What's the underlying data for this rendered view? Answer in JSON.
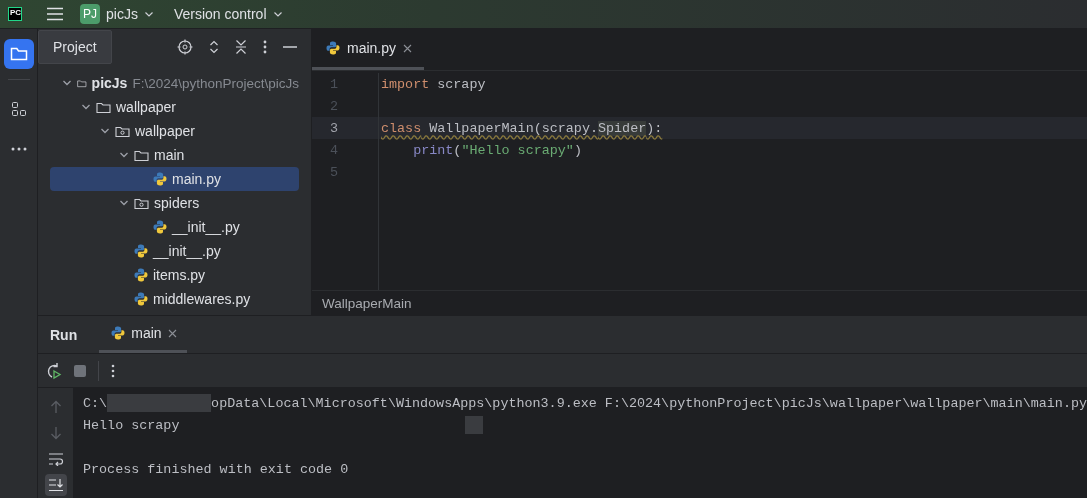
{
  "title_bar": {
    "logo": "PC",
    "project_badge": "PJ",
    "project": "picJs",
    "vcs": "Version control"
  },
  "tool_stripe": [
    {
      "kind": "project",
      "selected": true
    },
    {
      "kind": "structure",
      "selected": false
    },
    {
      "kind": "more",
      "selected": false
    }
  ],
  "project_panel": {
    "title": "Project",
    "tree": [
      {
        "label": "picJs",
        "path": "F:\\2024\\pythonProject\\picJs",
        "kind": "folder",
        "expanded": true,
        "selected": false,
        "children": [
          {
            "label": "wallpaper",
            "kind": "folder",
            "expanded": true,
            "selected": false,
            "children": [
              {
                "label": "wallpaper",
                "kind": "package",
                "expanded": true,
                "selected": false,
                "children": [
                  {
                    "label": "main",
                    "kind": "folder",
                    "expanded": true,
                    "selected": false,
                    "children": [
                      {
                        "label": "main.py",
                        "kind": "python",
                        "selected": true
                      }
                    ]
                  },
                  {
                    "label": "spiders",
                    "kind": "package",
                    "expanded": true,
                    "selected": false,
                    "children": [
                      {
                        "label": "__init__.py",
                        "kind": "python",
                        "selected": false
                      }
                    ]
                  },
                  {
                    "label": "__init__.py",
                    "kind": "python",
                    "selected": false
                  },
                  {
                    "label": "items.py",
                    "kind": "python",
                    "selected": false
                  },
                  {
                    "label": "middlewares.py",
                    "kind": "python",
                    "selected": false
                  }
                ]
              }
            ]
          }
        ]
      }
    ]
  },
  "editor": {
    "tabs": [
      {
        "label": "main.py",
        "selected": true
      }
    ],
    "lines": [
      {
        "number": "1",
        "current": false,
        "tokens": [
          {
            "text": "import",
            "kind": "keyword",
            "highlighted": false,
            "warning": false
          },
          {
            "text": " scrapy",
            "kind": "name",
            "highlighted": false,
            "warning": false
          }
        ]
      },
      {
        "number": "2",
        "current": false
      },
      {
        "number": "3",
        "current": true,
        "tokens": [
          {
            "text": "class",
            "kind": "keyword",
            "highlighted": false,
            "warning": true
          },
          {
            "text": " WallpaperMain(scrapy.",
            "kind": "name",
            "highlighted": false,
            "warning": true
          },
          {
            "text": "Spider",
            "kind": "name",
            "highlighted": true,
            "warning": true
          },
          {
            "text": "):",
            "kind": "name",
            "highlighted": false,
            "warning": true
          }
        ]
      },
      {
        "number": "4",
        "current": false,
        "tokens": [
          {
            "text": "    print",
            "kind": "builtin",
            "highlighted": false,
            "warning": false
          },
          {
            "text": "(",
            "kind": "name",
            "highlighted": false,
            "warning": false
          },
          {
            "text": "\"Hello scrapy\"",
            "kind": "string",
            "highlighted": false,
            "warning": false
          },
          {
            "text": ")",
            "kind": "name",
            "highlighted": false,
            "warning": false
          }
        ]
      },
      {
        "number": "5",
        "current": false
      }
    ],
    "breadcrumb": "WallpaperMain"
  },
  "run_panel": {
    "title": "Run",
    "tabs": [
      {
        "label": "main",
        "selected": true
      }
    ],
    "console_tools": [
      {
        "kind": "up",
        "selected": false
      },
      {
        "kind": "down",
        "selected": false
      },
      {
        "kind": "wrap",
        "selected": false
      },
      {
        "kind": "scroll-end",
        "selected": true
      }
    ],
    "console": [
      {
        "kind": "command",
        "segments": [
          {
            "kind": "text",
            "text": "C:\\"
          },
          {
            "kind": "redaction"
          },
          {
            "kind": "text",
            "text": "opData\\Local\\Microsoft\\WindowsApps\\python3.9.exe F:\\2024\\pythonProject\\picJs\\wallpaper\\wallpaper\\main\\main.py"
          }
        ]
      },
      {
        "kind": "output",
        "segments": [
          {
            "kind": "text",
            "text": "Hello scrapy"
          },
          {
            "kind": "redaction"
          }
        ]
      },
      {
        "kind": "exit",
        "segments": [
          {
            "kind": "text",
            "text": "Process finished with exit code 0"
          }
        ]
      }
    ]
  }
}
